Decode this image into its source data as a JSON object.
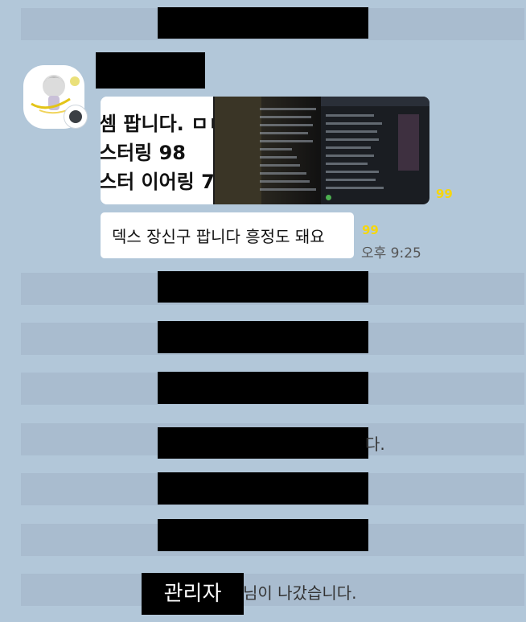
{
  "messages": {
    "image_text_lines": [
      "셈 팝니다. ㅁㅌ",
      "스터링 98",
      "스터 이어링 7"
    ],
    "image_read_count": "99",
    "text": "덱스 장신구 팝니다 흥정도 돼요",
    "read_count": "99",
    "time": "오후 9:25"
  },
  "system": {
    "partial_line_1": "다.",
    "partial_line_2": "님이 나갔습니다.",
    "admin_label": "관리자"
  }
}
